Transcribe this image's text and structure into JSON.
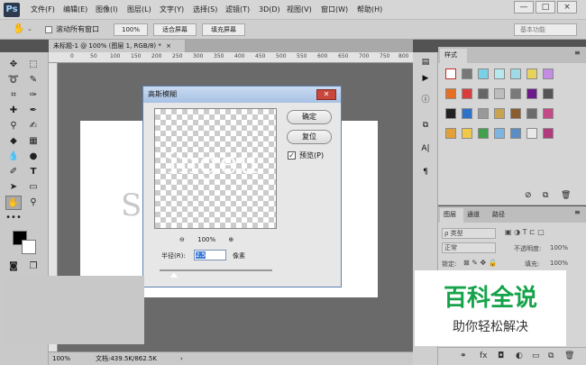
{
  "app": {
    "logo": "Ps"
  },
  "menubar": {
    "items": [
      "文件(F)",
      "编辑(E)",
      "图像(I)",
      "图层(L)",
      "文字(Y)",
      "选择(S)",
      "滤镜(T)",
      "3D(D)",
      "视图(V)",
      "窗口(W)",
      "帮助(H)"
    ],
    "window_controls": [
      "—",
      "□",
      "×"
    ]
  },
  "options": {
    "scroll_all_label": "滚动所有窗口",
    "zoom_value": "100%",
    "fit_screen": "适合屏幕",
    "fill_screen": "填充屏幕",
    "workspace": "基本功能"
  },
  "document": {
    "tab_title": "未标题-1 @ 100% (图层 1, RGB/8) *",
    "tab_close": "×",
    "bg_text": "S"
  },
  "ruler": {
    "h_labels": [
      "0",
      "50",
      "100",
      "150",
      "200",
      "250",
      "300",
      "350",
      "400",
      "450",
      "500",
      "550",
      "600",
      "650",
      "700",
      "750",
      "800"
    ]
  },
  "status": {
    "zoom": "100%",
    "doc_info": "文档:439.5K/862.5K",
    "arrow": "›"
  },
  "dialog": {
    "title": "高斯模糊",
    "close": "✕",
    "ok": "确定",
    "reset": "复位",
    "preview_label": "预览(P)",
    "preview_checked": "✓",
    "preview_text": "ingeu",
    "zoom": "100%",
    "zoom_out": "⊖",
    "zoom_in": "⊕",
    "radius_label": "半径(R):",
    "radius_value": "2.5",
    "unit": "像素"
  },
  "styles_panel": {
    "tab": "样式"
  },
  "layers_panel": {
    "tabs": [
      "图层",
      "通道",
      "路径"
    ],
    "kind": "ρ 类型",
    "mode": "正常",
    "opacity_label": "不透明度:",
    "opacity": "100%",
    "lock_label": "锁定:",
    "fill_label": "填充:",
    "fill": "100%"
  },
  "watermark": {
    "title": "百科全说",
    "subtitle": "助你轻松解决"
  },
  "colors": {
    "accent": "#15a34a"
  }
}
